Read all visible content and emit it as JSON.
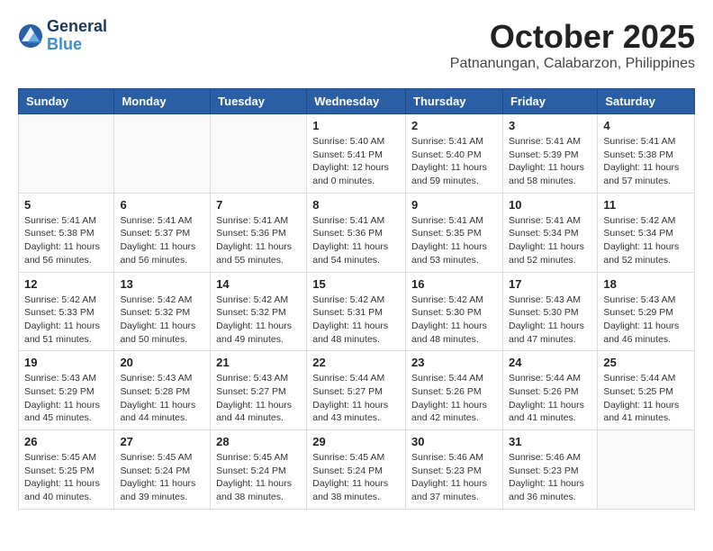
{
  "header": {
    "logo_line1": "General",
    "logo_line2": "Blue",
    "month": "October 2025",
    "location": "Patnanungan, Calabarzon, Philippines"
  },
  "weekdays": [
    "Sunday",
    "Monday",
    "Tuesday",
    "Wednesday",
    "Thursday",
    "Friday",
    "Saturday"
  ],
  "weeks": [
    [
      {
        "day": "",
        "sunrise": "",
        "sunset": "",
        "daylight": ""
      },
      {
        "day": "",
        "sunrise": "",
        "sunset": "",
        "daylight": ""
      },
      {
        "day": "",
        "sunrise": "",
        "sunset": "",
        "daylight": ""
      },
      {
        "day": "1",
        "sunrise": "Sunrise: 5:40 AM",
        "sunset": "Sunset: 5:41 PM",
        "daylight": "Daylight: 12 hours and 0 minutes."
      },
      {
        "day": "2",
        "sunrise": "Sunrise: 5:41 AM",
        "sunset": "Sunset: 5:40 PM",
        "daylight": "Daylight: 11 hours and 59 minutes."
      },
      {
        "day": "3",
        "sunrise": "Sunrise: 5:41 AM",
        "sunset": "Sunset: 5:39 PM",
        "daylight": "Daylight: 11 hours and 58 minutes."
      },
      {
        "day": "4",
        "sunrise": "Sunrise: 5:41 AM",
        "sunset": "Sunset: 5:38 PM",
        "daylight": "Daylight: 11 hours and 57 minutes."
      }
    ],
    [
      {
        "day": "5",
        "sunrise": "Sunrise: 5:41 AM",
        "sunset": "Sunset: 5:38 PM",
        "daylight": "Daylight: 11 hours and 56 minutes."
      },
      {
        "day": "6",
        "sunrise": "Sunrise: 5:41 AM",
        "sunset": "Sunset: 5:37 PM",
        "daylight": "Daylight: 11 hours and 56 minutes."
      },
      {
        "day": "7",
        "sunrise": "Sunrise: 5:41 AM",
        "sunset": "Sunset: 5:36 PM",
        "daylight": "Daylight: 11 hours and 55 minutes."
      },
      {
        "day": "8",
        "sunrise": "Sunrise: 5:41 AM",
        "sunset": "Sunset: 5:36 PM",
        "daylight": "Daylight: 11 hours and 54 minutes."
      },
      {
        "day": "9",
        "sunrise": "Sunrise: 5:41 AM",
        "sunset": "Sunset: 5:35 PM",
        "daylight": "Daylight: 11 hours and 53 minutes."
      },
      {
        "day": "10",
        "sunrise": "Sunrise: 5:41 AM",
        "sunset": "Sunset: 5:34 PM",
        "daylight": "Daylight: 11 hours and 52 minutes."
      },
      {
        "day": "11",
        "sunrise": "Sunrise: 5:42 AM",
        "sunset": "Sunset: 5:34 PM",
        "daylight": "Daylight: 11 hours and 52 minutes."
      }
    ],
    [
      {
        "day": "12",
        "sunrise": "Sunrise: 5:42 AM",
        "sunset": "Sunset: 5:33 PM",
        "daylight": "Daylight: 11 hours and 51 minutes."
      },
      {
        "day": "13",
        "sunrise": "Sunrise: 5:42 AM",
        "sunset": "Sunset: 5:32 PM",
        "daylight": "Daylight: 11 hours and 50 minutes."
      },
      {
        "day": "14",
        "sunrise": "Sunrise: 5:42 AM",
        "sunset": "Sunset: 5:32 PM",
        "daylight": "Daylight: 11 hours and 49 minutes."
      },
      {
        "day": "15",
        "sunrise": "Sunrise: 5:42 AM",
        "sunset": "Sunset: 5:31 PM",
        "daylight": "Daylight: 11 hours and 48 minutes."
      },
      {
        "day": "16",
        "sunrise": "Sunrise: 5:42 AM",
        "sunset": "Sunset: 5:30 PM",
        "daylight": "Daylight: 11 hours and 48 minutes."
      },
      {
        "day": "17",
        "sunrise": "Sunrise: 5:43 AM",
        "sunset": "Sunset: 5:30 PM",
        "daylight": "Daylight: 11 hours and 47 minutes."
      },
      {
        "day": "18",
        "sunrise": "Sunrise: 5:43 AM",
        "sunset": "Sunset: 5:29 PM",
        "daylight": "Daylight: 11 hours and 46 minutes."
      }
    ],
    [
      {
        "day": "19",
        "sunrise": "Sunrise: 5:43 AM",
        "sunset": "Sunset: 5:29 PM",
        "daylight": "Daylight: 11 hours and 45 minutes."
      },
      {
        "day": "20",
        "sunrise": "Sunrise: 5:43 AM",
        "sunset": "Sunset: 5:28 PM",
        "daylight": "Daylight: 11 hours and 44 minutes."
      },
      {
        "day": "21",
        "sunrise": "Sunrise: 5:43 AM",
        "sunset": "Sunset: 5:27 PM",
        "daylight": "Daylight: 11 hours and 44 minutes."
      },
      {
        "day": "22",
        "sunrise": "Sunrise: 5:44 AM",
        "sunset": "Sunset: 5:27 PM",
        "daylight": "Daylight: 11 hours and 43 minutes."
      },
      {
        "day": "23",
        "sunrise": "Sunrise: 5:44 AM",
        "sunset": "Sunset: 5:26 PM",
        "daylight": "Daylight: 11 hours and 42 minutes."
      },
      {
        "day": "24",
        "sunrise": "Sunrise: 5:44 AM",
        "sunset": "Sunset: 5:26 PM",
        "daylight": "Daylight: 11 hours and 41 minutes."
      },
      {
        "day": "25",
        "sunrise": "Sunrise: 5:44 AM",
        "sunset": "Sunset: 5:25 PM",
        "daylight": "Daylight: 11 hours and 41 minutes."
      }
    ],
    [
      {
        "day": "26",
        "sunrise": "Sunrise: 5:45 AM",
        "sunset": "Sunset: 5:25 PM",
        "daylight": "Daylight: 11 hours and 40 minutes."
      },
      {
        "day": "27",
        "sunrise": "Sunrise: 5:45 AM",
        "sunset": "Sunset: 5:24 PM",
        "daylight": "Daylight: 11 hours and 39 minutes."
      },
      {
        "day": "28",
        "sunrise": "Sunrise: 5:45 AM",
        "sunset": "Sunset: 5:24 PM",
        "daylight": "Daylight: 11 hours and 38 minutes."
      },
      {
        "day": "29",
        "sunrise": "Sunrise: 5:45 AM",
        "sunset": "Sunset: 5:24 PM",
        "daylight": "Daylight: 11 hours and 38 minutes."
      },
      {
        "day": "30",
        "sunrise": "Sunrise: 5:46 AM",
        "sunset": "Sunset: 5:23 PM",
        "daylight": "Daylight: 11 hours and 37 minutes."
      },
      {
        "day": "31",
        "sunrise": "Sunrise: 5:46 AM",
        "sunset": "Sunset: 5:23 PM",
        "daylight": "Daylight: 11 hours and 36 minutes."
      },
      {
        "day": "",
        "sunrise": "",
        "sunset": "",
        "daylight": ""
      }
    ]
  ]
}
